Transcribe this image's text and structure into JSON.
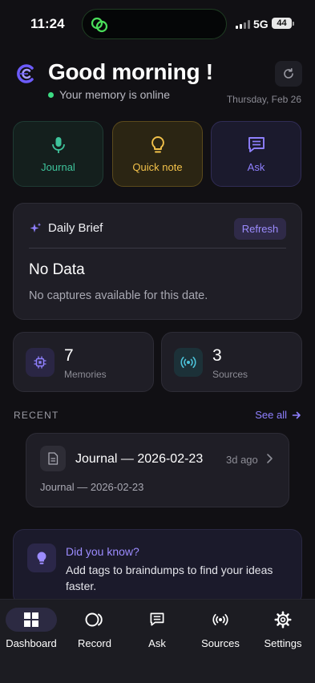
{
  "status": {
    "time": "11:24",
    "network": "5G",
    "battery": "44"
  },
  "header": {
    "greeting": "Good morning !",
    "memory_status": "Your memory is online",
    "date": "Thursday, Feb 26"
  },
  "quick_actions": [
    {
      "label": "Journal",
      "icon": "microphone-icon",
      "color": "#3ec39b"
    },
    {
      "label": "Quick note",
      "icon": "lightbulb-icon",
      "color": "#f3c24a"
    },
    {
      "label": "Ask",
      "icon": "chat-icon",
      "color": "#8f80ff"
    }
  ],
  "daily_brief": {
    "title": "Daily Brief",
    "refresh_label": "Refresh",
    "empty_title": "No Data",
    "empty_desc": "No captures available for this date."
  },
  "stats": [
    {
      "value": "7",
      "label": "Memories",
      "icon": "chip-icon"
    },
    {
      "value": "3",
      "label": "Sources",
      "icon": "broadcast-icon"
    }
  ],
  "recent": {
    "section_label": "RECENT",
    "see_all_label": "See all",
    "items": [
      {
        "title": "Journal — 2026-02-23",
        "ago": "3d ago",
        "subtitle": "Journal — 2026-02-23"
      }
    ]
  },
  "tip": {
    "title": "Did you know?",
    "text": "Add tags to braindumps to find your ideas faster."
  },
  "tabs": [
    {
      "label": "Dashboard",
      "icon": "dashboard-icon",
      "active": true
    },
    {
      "label": "Record",
      "icon": "record-icon",
      "active": false
    },
    {
      "label": "Ask",
      "icon": "chat-icon",
      "active": false
    },
    {
      "label": "Sources",
      "icon": "broadcast-icon",
      "active": false
    },
    {
      "label": "Settings",
      "icon": "gear-icon",
      "active": false
    }
  ],
  "colors": {
    "accent": "#8f80ff",
    "background": "#111014",
    "online": "#3ddc84"
  }
}
